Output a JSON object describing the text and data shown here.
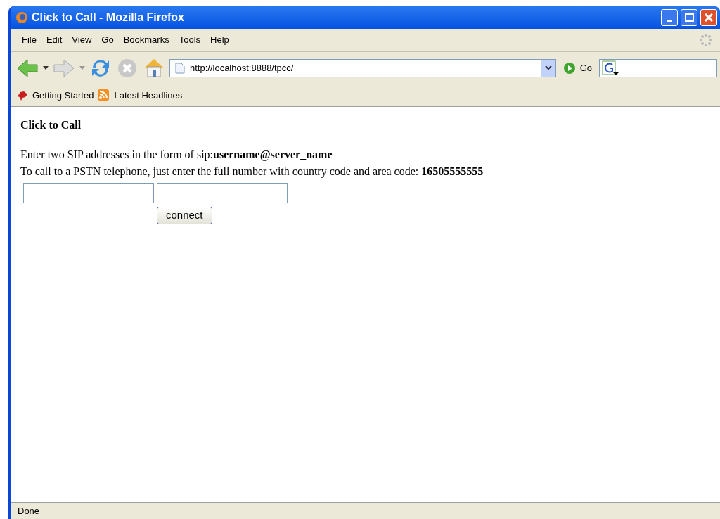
{
  "window": {
    "title": "Click to Call - Mozilla Firefox"
  },
  "menu": [
    "File",
    "Edit",
    "View",
    "Go",
    "Bookmarks",
    "Tools",
    "Help"
  ],
  "toolbar": {
    "address": "http://localhost:8888/tpcc/",
    "go_label": "Go"
  },
  "bookmarks": [
    {
      "kind": "page",
      "label": "Getting Started"
    },
    {
      "kind": "feed",
      "label": "Latest Headlines"
    }
  ],
  "page": {
    "heading": "Click to Call",
    "lines": [
      "Enter two SIP addresses in the form of sip:**username@server_name**",
      "To call to a PSTN telephone, just enter the full number with country code and area code: **16505555555**"
    ],
    "button": "connect"
  },
  "status_bar": {
    "text": "Done"
  }
}
